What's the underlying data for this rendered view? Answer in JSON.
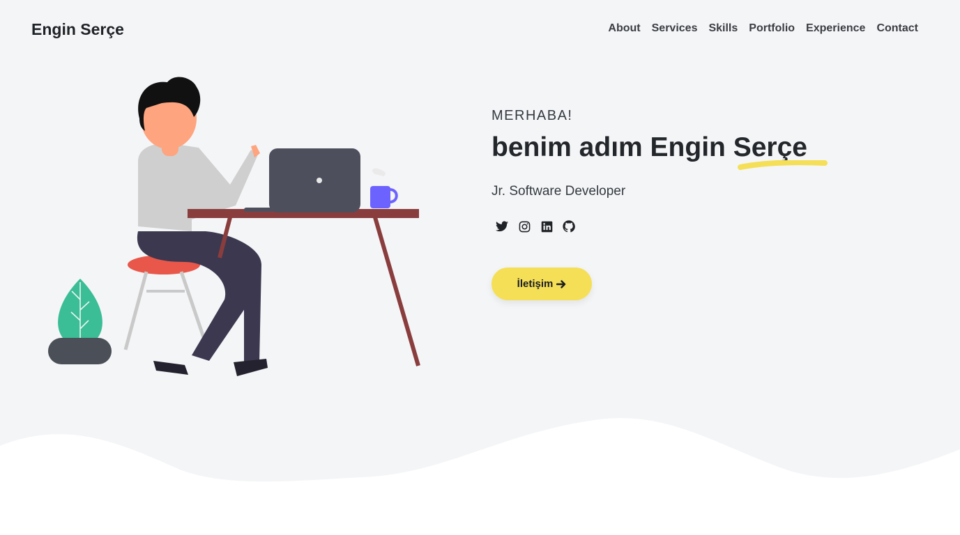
{
  "brand": "Engin Serçe",
  "nav": [
    "About",
    "Services",
    "Skills",
    "Portfolio",
    "Experience",
    "Contact"
  ],
  "hero": {
    "greeting": "MERHABA!",
    "headline_prefix": "benim adım Engin",
    "headline_last": "Serçe",
    "role": "Jr. Software Developer",
    "cta_label": "İletişim",
    "cta_icon": "arrow-right-icon"
  },
  "socials": [
    "twitter-icon",
    "instagram-icon",
    "linkedin-icon",
    "github-icon"
  ],
  "colors": {
    "background": "#f4f5f7",
    "accent_yellow": "#f5df57",
    "text_dark": "#23262a",
    "wave": "#ffffff"
  }
}
